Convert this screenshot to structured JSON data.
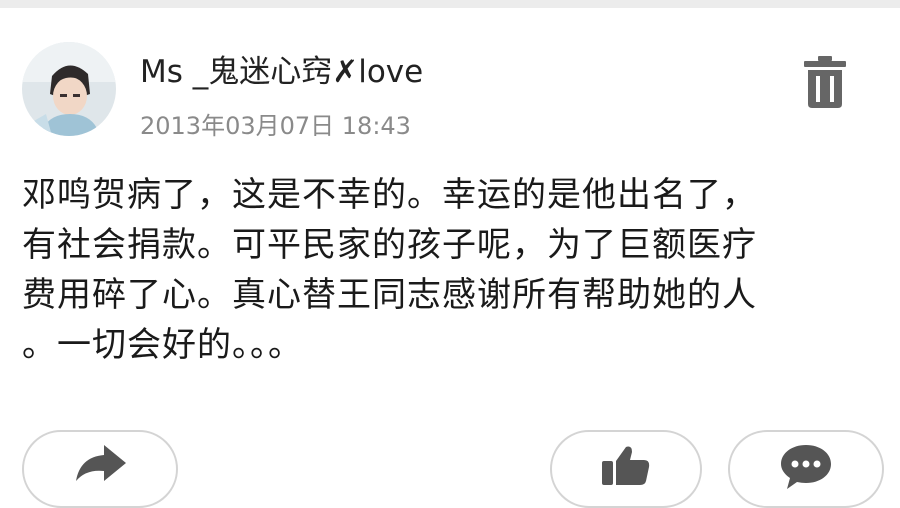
{
  "post": {
    "author": "Ms _鬼迷心窍✗love",
    "timestamp": "2013年03月07日 18:43",
    "lines": [
      "邓鸣贺病了，这是不幸的。幸运的是他出名了，",
      "有社会捐款。可平民家的孩子呢，为了巨额医疗",
      "费用碎了心。真心替王同志感谢所有帮助她的人",
      "。一切会好的。。。"
    ]
  },
  "icons": {
    "delete": "trash-icon",
    "share": "share-arrow-icon",
    "like": "thumbs-up-icon",
    "comment": "comment-bubble-icon"
  },
  "colors": {
    "text": "#1a1a1a",
    "meta": "#8a8a8a",
    "icon": "#555555",
    "border": "#d4d4d4"
  }
}
